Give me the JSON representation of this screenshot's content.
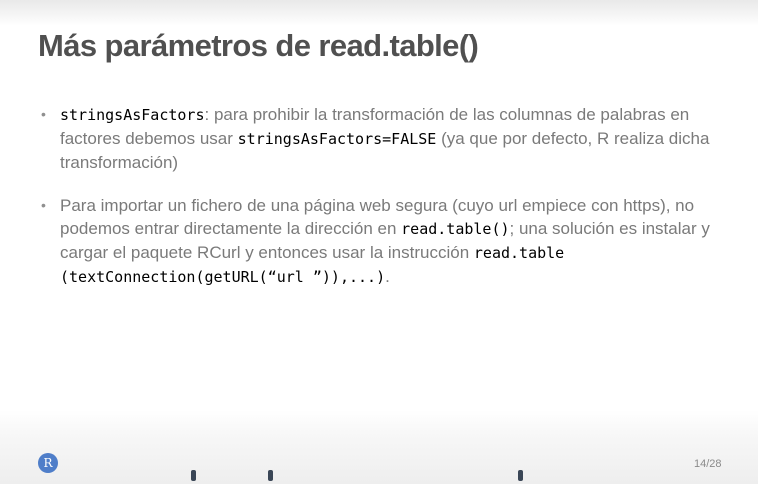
{
  "slide": {
    "title": "Más parámetros de read.table()",
    "page_indicator": "14/28",
    "logo_letter": "R"
  },
  "bullets": [
    {
      "code_lead": "stringsAsFactors",
      "text_1": ": para prohibir la transformación de las columnas de palabras en factores debemos usar ",
      "code_1": "stringsAsFactors=FALSE",
      "text_2": " (ya que por defecto, R realiza dicha transformación)"
    },
    {
      "text_1": "Para importar un fichero de una página web segura (cuyo url empiece con https), no podemos entrar directamente la dirección en ",
      "code_1": "read.table()",
      "text_2": "; una solución es instalar y cargar el paquete RCurl y entonces usar la instrucción ",
      "code_2": "read.table (textConnection(getURL(“url ”)),...)",
      "text_3": "."
    }
  ],
  "icons": {
    "logo": "r-logo-icon",
    "bullet": "bullet-dot-icon"
  },
  "colors": {
    "title": "#505050",
    "body_text": "#7a7a7a",
    "code_text": "#000000",
    "logo_bg": "#4f7ec9",
    "progress_tick": "#3a4656"
  }
}
